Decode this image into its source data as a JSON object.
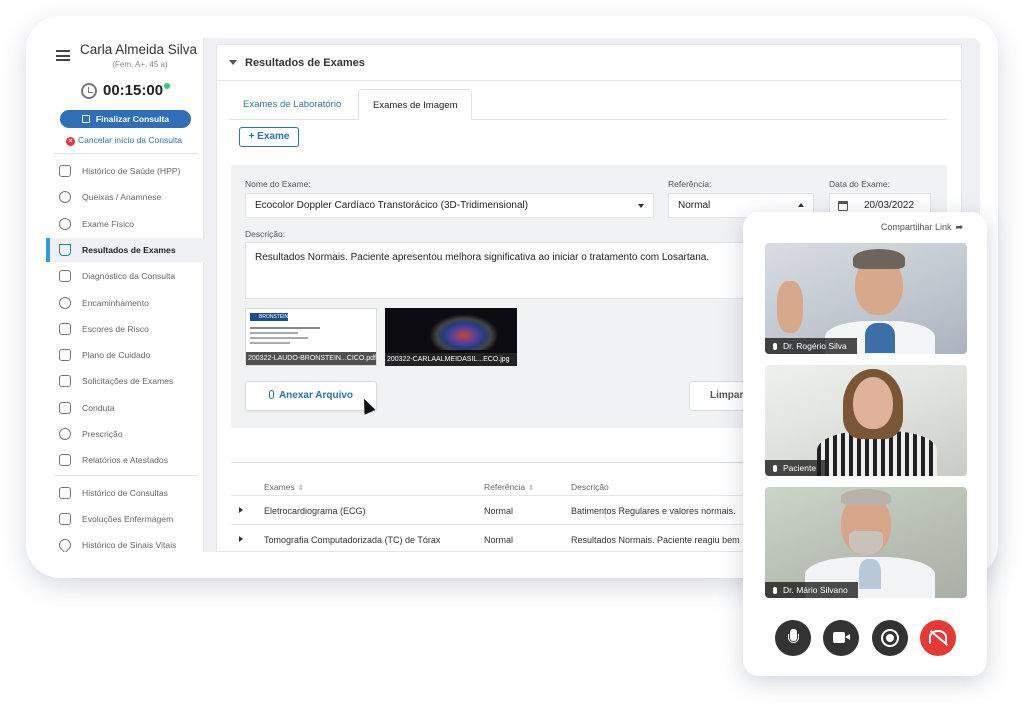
{
  "patient": {
    "name": "Carla Almeida Silva",
    "info": "(Fem, A+, 45 a)"
  },
  "consult": {
    "timer": "00:15:00",
    "finish_label": "Finalizar Consulta",
    "cancel_label": "Cancelar início da Consulta"
  },
  "sidebar": {
    "items": [
      {
        "label": "Histórico de Saúde (HPP)",
        "icon": "health-history-icon"
      },
      {
        "label": "Queixas / Anamnese",
        "icon": "head-icon"
      },
      {
        "label": "Exame Físico",
        "icon": "hand-icon"
      },
      {
        "label": "Resultados de Exames",
        "icon": "flask-icon",
        "active": true
      },
      {
        "label": "Diagnóstico da Consulta",
        "icon": "clipboard-icon"
      },
      {
        "label": "Encaminhamento",
        "icon": "people-icon"
      },
      {
        "label": "Escores de Risco",
        "icon": "calculator-icon"
      },
      {
        "label": "Plano de Cuidado",
        "icon": "care-hand-icon"
      },
      {
        "label": "Solicitações de Exames",
        "icon": "documents-icon"
      },
      {
        "label": "Conduta",
        "icon": "conduct-icon"
      },
      {
        "label": "Prescrição",
        "icon": "pills-icon"
      },
      {
        "label": "Relatórios e Atestados",
        "icon": "report-icon"
      }
    ],
    "history": [
      {
        "label": "Histórico de Consultas",
        "icon": "calendar-icon"
      },
      {
        "label": "Evoluções Enfermagem",
        "icon": "calendar-icon"
      },
      {
        "label": "Histórico de Sinais Vitais",
        "icon": "heart-icon"
      }
    ]
  },
  "main": {
    "section_title": "Resultados de Exames",
    "tabs": [
      "Exames de Laboratório",
      "Exames de Imagem"
    ],
    "active_tab": 1,
    "add_button": "+ Exame",
    "form": {
      "name_label": "Nome do Exame:",
      "name_value": "Ecocolor Doppler Cardíaco Transtorácico (3D-Tridimensional)",
      "ref_label": "Referência:",
      "ref_value": "Normal",
      "date_label": "Data do Exame:",
      "date_value": "20/03/2022",
      "desc_label": "Descrição:",
      "desc_value": "Resultados Normais. Paciente apresentou melhora significativa ao iniciar o tratamento com Losartana.",
      "files": [
        "200322-LAUDO-BRONSTEIN...CICO.pdf",
        "200322-CARLAALMEIDASIL...ECO.jpg"
      ],
      "doc_brand": "BRONSTEIN",
      "attach_label": "Anexar Arquivo",
      "clear_label": "Limpar"
    },
    "table": {
      "headers": [
        "Exames",
        "Referência",
        "Descrição"
      ],
      "rows": [
        {
          "exam": "Eletrocardiograma (ECG)",
          "ref": "Normal",
          "desc": "Batimentos Regulares e valores normais."
        },
        {
          "exam": "Tomografia Computadorizada (TC) de Tórax",
          "ref": "Normal",
          "desc": "Resultados Normais. Paciente reagiu bem"
        }
      ]
    }
  },
  "video": {
    "share_label": "Compartilhar Link",
    "participants": [
      "Dr. Rogério Silva",
      "Paciente",
      "Dr. Mário Silvano"
    ],
    "controls": [
      "microphone-icon",
      "camera-icon",
      "record-icon",
      "hangup-icon"
    ],
    "end_color": "#e53935"
  }
}
